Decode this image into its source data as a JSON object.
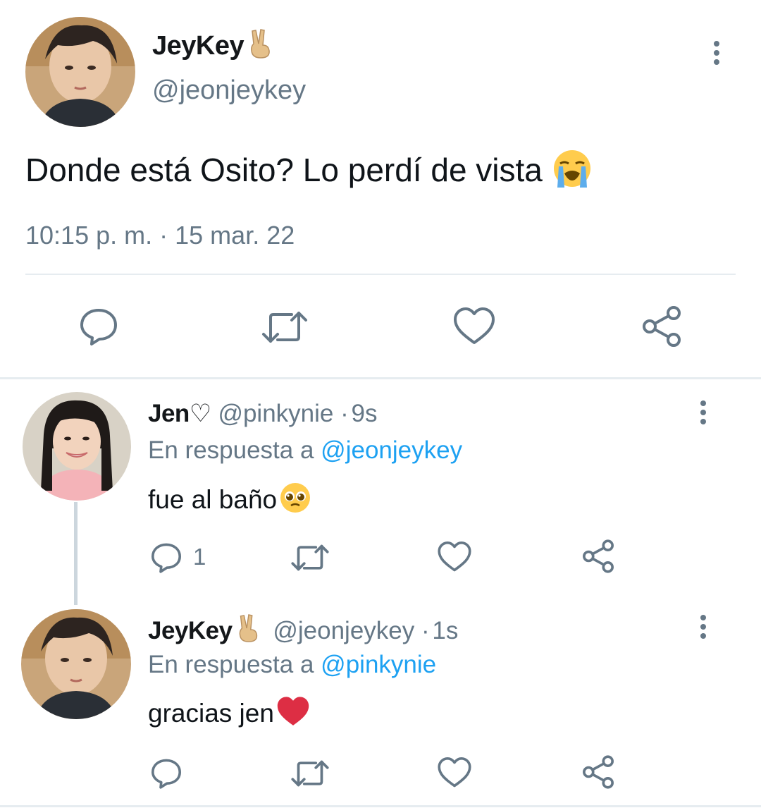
{
  "main_tweet": {
    "display_name": "JeyKey",
    "name_emoji": "victory-hand-emoji",
    "handle": "@jeonjeykey",
    "text": "Donde está Osito? Lo perdí de vista",
    "text_emoji": "loudly-crying-face-emoji",
    "time": "10:15 p. m.",
    "separator": "·",
    "date": "15 mar. 22",
    "actions": [
      "reply-icon",
      "retweet-icon",
      "like-icon",
      "share-icon"
    ]
  },
  "replies": [
    {
      "display_name": "Jen",
      "name_suffix": "♡",
      "handle": "@pinkynie",
      "separator": "·",
      "time": "9s",
      "reply_prefix": "En respuesta a",
      "reply_to": "@jeonjeykey",
      "text": "fue al baño",
      "text_emoji": "pleading-face-emoji",
      "reply_count": "1"
    },
    {
      "display_name": "JeyKey",
      "name_emoji": "victory-hand-emoji",
      "handle": "@jeonjeykey",
      "separator": "·",
      "time": "1s",
      "reply_prefix": "En respuesta a",
      "reply_to": "@pinkynie",
      "text": "gracias jen",
      "text_emoji": "red-heart-emoji"
    }
  ],
  "colors": {
    "text": "#14171a",
    "muted": "#657786",
    "link": "#1da1f2",
    "divider": "#e6ecf0"
  }
}
